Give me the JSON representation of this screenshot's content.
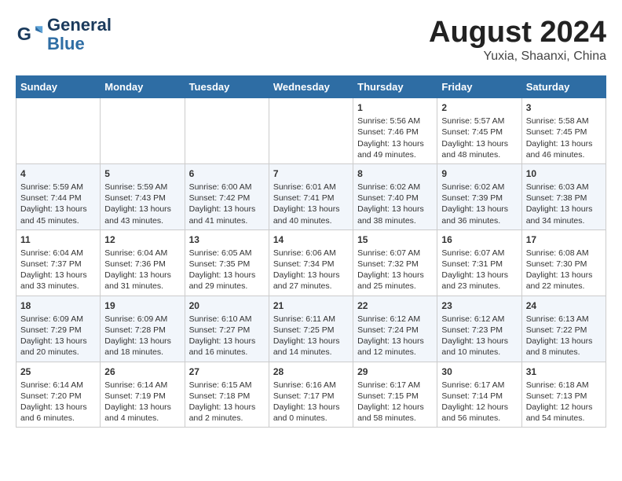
{
  "header": {
    "logo_line1": "General",
    "logo_line2": "Blue",
    "title": "August 2024",
    "subtitle": "Yuxia, Shaanxi, China"
  },
  "days_of_week": [
    "Sunday",
    "Monday",
    "Tuesday",
    "Wednesday",
    "Thursday",
    "Friday",
    "Saturday"
  ],
  "weeks": [
    [
      {
        "day": "",
        "content": ""
      },
      {
        "day": "",
        "content": ""
      },
      {
        "day": "",
        "content": ""
      },
      {
        "day": "",
        "content": ""
      },
      {
        "day": "1",
        "content": "Sunrise: 5:56 AM\nSunset: 7:46 PM\nDaylight: 13 hours\nand 49 minutes."
      },
      {
        "day": "2",
        "content": "Sunrise: 5:57 AM\nSunset: 7:45 PM\nDaylight: 13 hours\nand 48 minutes."
      },
      {
        "day": "3",
        "content": "Sunrise: 5:58 AM\nSunset: 7:45 PM\nDaylight: 13 hours\nand 46 minutes."
      }
    ],
    [
      {
        "day": "4",
        "content": "Sunrise: 5:59 AM\nSunset: 7:44 PM\nDaylight: 13 hours\nand 45 minutes."
      },
      {
        "day": "5",
        "content": "Sunrise: 5:59 AM\nSunset: 7:43 PM\nDaylight: 13 hours\nand 43 minutes."
      },
      {
        "day": "6",
        "content": "Sunrise: 6:00 AM\nSunset: 7:42 PM\nDaylight: 13 hours\nand 41 minutes."
      },
      {
        "day": "7",
        "content": "Sunrise: 6:01 AM\nSunset: 7:41 PM\nDaylight: 13 hours\nand 40 minutes."
      },
      {
        "day": "8",
        "content": "Sunrise: 6:02 AM\nSunset: 7:40 PM\nDaylight: 13 hours\nand 38 minutes."
      },
      {
        "day": "9",
        "content": "Sunrise: 6:02 AM\nSunset: 7:39 PM\nDaylight: 13 hours\nand 36 minutes."
      },
      {
        "day": "10",
        "content": "Sunrise: 6:03 AM\nSunset: 7:38 PM\nDaylight: 13 hours\nand 34 minutes."
      }
    ],
    [
      {
        "day": "11",
        "content": "Sunrise: 6:04 AM\nSunset: 7:37 PM\nDaylight: 13 hours\nand 33 minutes."
      },
      {
        "day": "12",
        "content": "Sunrise: 6:04 AM\nSunset: 7:36 PM\nDaylight: 13 hours\nand 31 minutes."
      },
      {
        "day": "13",
        "content": "Sunrise: 6:05 AM\nSunset: 7:35 PM\nDaylight: 13 hours\nand 29 minutes."
      },
      {
        "day": "14",
        "content": "Sunrise: 6:06 AM\nSunset: 7:34 PM\nDaylight: 13 hours\nand 27 minutes."
      },
      {
        "day": "15",
        "content": "Sunrise: 6:07 AM\nSunset: 7:32 PM\nDaylight: 13 hours\nand 25 minutes."
      },
      {
        "day": "16",
        "content": "Sunrise: 6:07 AM\nSunset: 7:31 PM\nDaylight: 13 hours\nand 23 minutes."
      },
      {
        "day": "17",
        "content": "Sunrise: 6:08 AM\nSunset: 7:30 PM\nDaylight: 13 hours\nand 22 minutes."
      }
    ],
    [
      {
        "day": "18",
        "content": "Sunrise: 6:09 AM\nSunset: 7:29 PM\nDaylight: 13 hours\nand 20 minutes."
      },
      {
        "day": "19",
        "content": "Sunrise: 6:09 AM\nSunset: 7:28 PM\nDaylight: 13 hours\nand 18 minutes."
      },
      {
        "day": "20",
        "content": "Sunrise: 6:10 AM\nSunset: 7:27 PM\nDaylight: 13 hours\nand 16 minutes."
      },
      {
        "day": "21",
        "content": "Sunrise: 6:11 AM\nSunset: 7:25 PM\nDaylight: 13 hours\nand 14 minutes."
      },
      {
        "day": "22",
        "content": "Sunrise: 6:12 AM\nSunset: 7:24 PM\nDaylight: 13 hours\nand 12 minutes."
      },
      {
        "day": "23",
        "content": "Sunrise: 6:12 AM\nSunset: 7:23 PM\nDaylight: 13 hours\nand 10 minutes."
      },
      {
        "day": "24",
        "content": "Sunrise: 6:13 AM\nSunset: 7:22 PM\nDaylight: 13 hours\nand 8 minutes."
      }
    ],
    [
      {
        "day": "25",
        "content": "Sunrise: 6:14 AM\nSunset: 7:20 PM\nDaylight: 13 hours\nand 6 minutes."
      },
      {
        "day": "26",
        "content": "Sunrise: 6:14 AM\nSunset: 7:19 PM\nDaylight: 13 hours\nand 4 minutes."
      },
      {
        "day": "27",
        "content": "Sunrise: 6:15 AM\nSunset: 7:18 PM\nDaylight: 13 hours\nand 2 minutes."
      },
      {
        "day": "28",
        "content": "Sunrise: 6:16 AM\nSunset: 7:17 PM\nDaylight: 13 hours\nand 0 minutes."
      },
      {
        "day": "29",
        "content": "Sunrise: 6:17 AM\nSunset: 7:15 PM\nDaylight: 12 hours\nand 58 minutes."
      },
      {
        "day": "30",
        "content": "Sunrise: 6:17 AM\nSunset: 7:14 PM\nDaylight: 12 hours\nand 56 minutes."
      },
      {
        "day": "31",
        "content": "Sunrise: 6:18 AM\nSunset: 7:13 PM\nDaylight: 12 hours\nand 54 minutes."
      }
    ]
  ]
}
